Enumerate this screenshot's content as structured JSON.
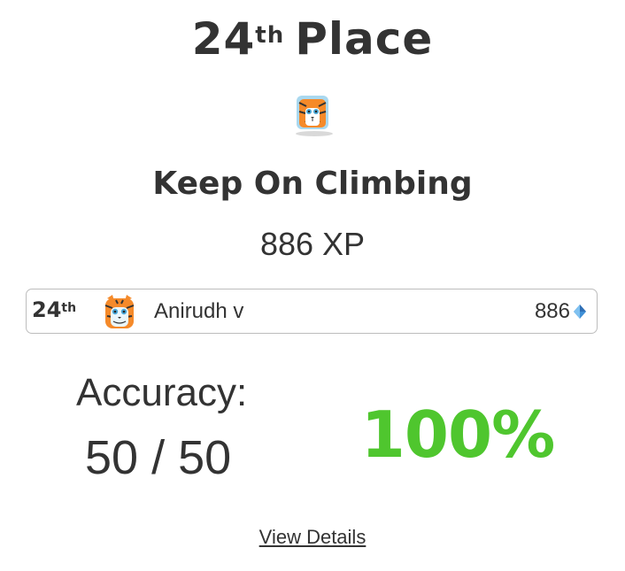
{
  "result": {
    "rank_number": "24",
    "rank_suffix": "th",
    "rank_word": "Place",
    "tagline": "Keep On Climbing",
    "xp_text": "886 XP"
  },
  "leaderboard_row": {
    "rank_number": "24",
    "rank_suffix": "th",
    "name": "Anirudh v",
    "score": "886",
    "avatar_icon": "tiger-icon",
    "score_icon": "gem-icon"
  },
  "accuracy": {
    "label": "Accuracy:",
    "fraction": "50 / 50",
    "percent": "100%",
    "percent_color": "#4fc62e"
  },
  "footer": {
    "details_link": "View Details"
  }
}
